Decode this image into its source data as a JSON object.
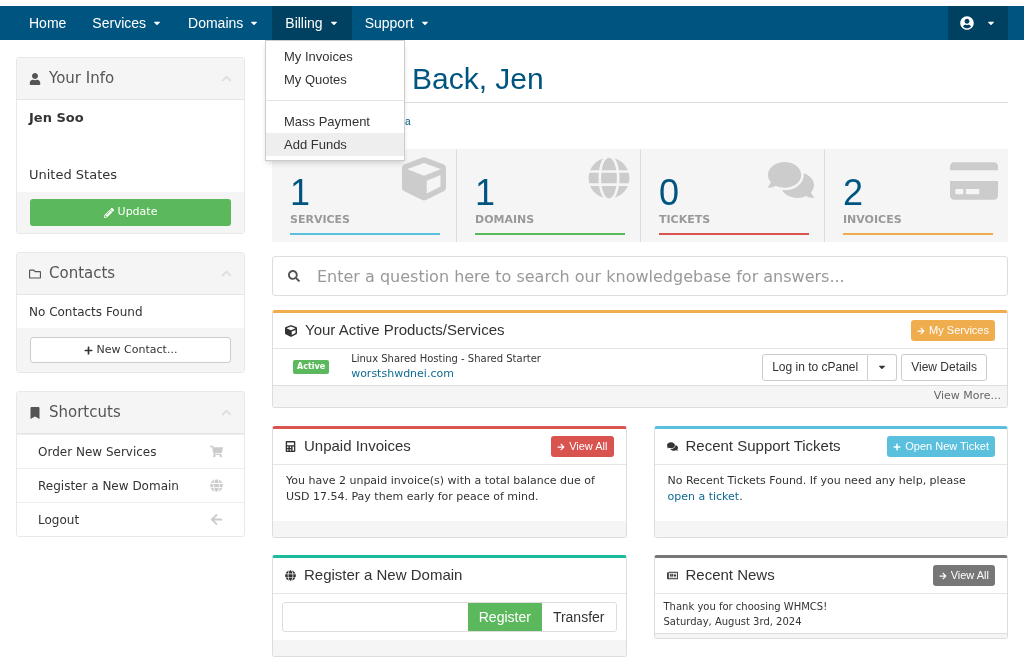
{
  "nav": {
    "items": [
      {
        "label": "Home",
        "dropdown": false,
        "selected": false
      },
      {
        "label": "Services",
        "dropdown": true,
        "selected": false
      },
      {
        "label": "Domains",
        "dropdown": true,
        "selected": false
      },
      {
        "label": "Billing",
        "dropdown": true,
        "selected": true
      },
      {
        "label": "Support",
        "dropdown": true,
        "selected": false
      }
    ],
    "billing_menu": {
      "groups": [
        [
          {
            "label": "My Invoices",
            "selected": false
          },
          {
            "label": "My Quotes",
            "selected": false
          }
        ],
        [
          {
            "label": "Mass Payment",
            "selected": false
          },
          {
            "label": "Add Funds",
            "selected": true
          }
        ]
      ]
    }
  },
  "sidebar": {
    "your_info": {
      "title": "Your Info",
      "name": "Jen Soo",
      "country": "United States",
      "button": "Update"
    },
    "contacts": {
      "title": "Contacts",
      "empty": "No Contacts Found",
      "button": "New Contact..."
    },
    "shortcuts": {
      "title": "Shortcuts",
      "items": [
        {
          "label": "Order New Services",
          "kind": "cart"
        },
        {
          "label": "Register a New Domain",
          "kind": "globe"
        },
        {
          "label": "Logout",
          "kind": "back"
        }
      ]
    }
  },
  "header": {
    "title": "Back, Jen",
    "breadcrumb": "a"
  },
  "stats": [
    {
      "value": "1",
      "label": "SERVICES",
      "kind": "services",
      "color": "#5bc0de"
    },
    {
      "value": "1",
      "label": "DOMAINS",
      "kind": "domains",
      "color": "#5cb85c"
    },
    {
      "value": "0",
      "label": "TICKETS",
      "kind": "tickets",
      "color": "#d9534f"
    },
    {
      "value": "2",
      "label": "INVOICES",
      "kind": "invoices",
      "color": "#f0ad4e"
    }
  ],
  "search": {
    "placeholder": "Enter a question here to search our knowledgebase for answers..."
  },
  "products": {
    "title": "Your Active Products/Services",
    "button": "My Services",
    "rows": [
      {
        "status": "Active",
        "product": "Linux Shared Hosting - Shared Starter",
        "domain": "worstshwdnei.com",
        "login": "Log in to cPanel",
        "details": "View Details"
      }
    ],
    "footer": "View More..."
  },
  "invoices": {
    "title": "Unpaid Invoices",
    "button": "View All",
    "text": "You have 2 unpaid invoice(s) with a total balance due of USD 17.54. Pay them early for peace of mind."
  },
  "tickets": {
    "title": "Recent Support Tickets",
    "button": "Open New Ticket",
    "text": "No Recent Tickets Found. If you need any help, please",
    "link": "open a ticket",
    "after": "."
  },
  "domain": {
    "title": "Register a New Domain",
    "register": "Register",
    "transfer": "Transfer"
  },
  "news": {
    "title": "Recent News",
    "button": "View All",
    "items": [
      {
        "title": "Thank you for choosing WHMCS!",
        "date": "Saturday, August 3rd, 2024"
      }
    ]
  }
}
